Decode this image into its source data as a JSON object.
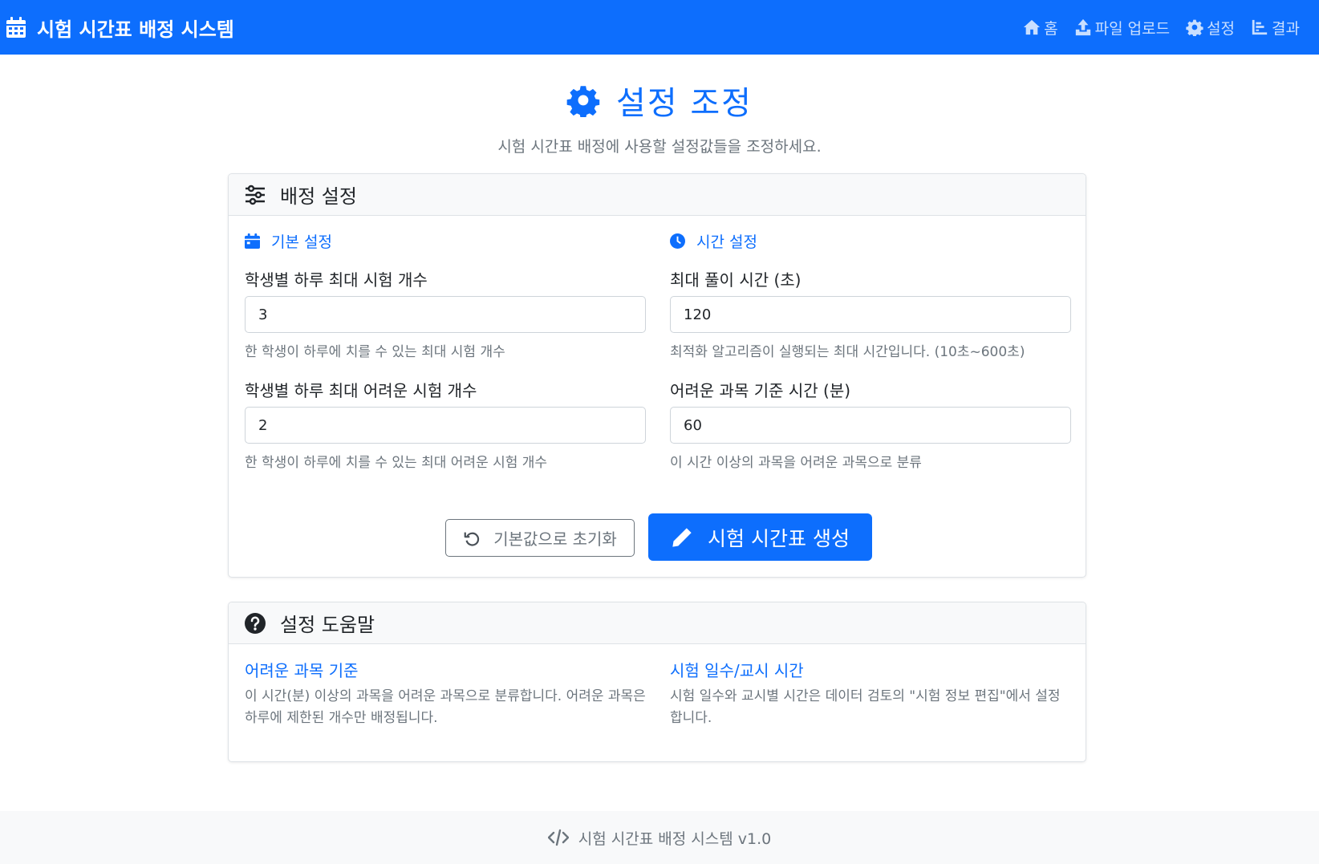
{
  "navbar": {
    "brand": "시험 시간표 배정 시스템",
    "items": [
      {
        "label": "홈",
        "icon": "home-icon"
      },
      {
        "label": "파일 업로드",
        "icon": "upload-icon"
      },
      {
        "label": "설정",
        "icon": "gear-icon"
      },
      {
        "label": "결과",
        "icon": "chart-icon"
      }
    ]
  },
  "header": {
    "title": "설정 조정",
    "subtitle": "시험 시간표 배정에 사용할 설정값들을 조정하세요."
  },
  "settings_card": {
    "title": "배정 설정",
    "basic": {
      "title": "기본 설정",
      "fields": [
        {
          "label": "학생별 하루 최대 시험 개수",
          "value": "3",
          "hint": "한 학생이 하루에 치를 수 있는 최대 시험 개수"
        },
        {
          "label": "학생별 하루 최대 어려운 시험 개수",
          "value": "2",
          "hint": "한 학생이 하루에 치를 수 있는 최대 어려운 시험 개수"
        }
      ]
    },
    "time": {
      "title": "시간 설정",
      "fields": [
        {
          "label": "최대 풀이 시간 (초)",
          "value": "120",
          "hint": "최적화 알고리즘이 실행되는 최대 시간입니다. (10초~600초)"
        },
        {
          "label": "어려운 과목 기준 시간 (분)",
          "value": "60",
          "hint": "이 시간 이상의 과목을 어려운 과목으로 분류"
        }
      ]
    },
    "reset_label": "기본값으로 초기화",
    "generate_label": "시험 시간표 생성"
  },
  "help_card": {
    "title": "설정 도움말",
    "items": [
      {
        "title": "어려운 과목 기준",
        "text": "이 시간(분) 이상의 과목을 어려운 과목으로 분류합니다. 어려운 과목은 하루에 제한된 개수만 배정됩니다."
      },
      {
        "title": "시험 일수/교시 시간",
        "text": "시험 일수와 교시별 시간은 데이터 검토의 \"시험 정보 편집\"에서 설정합니다."
      }
    ]
  },
  "footer": {
    "text": "시험 시간표 배정 시스템 v1.0"
  },
  "colors": {
    "primary": "#0d6efd",
    "muted": "#6c757d",
    "header_bg": "#f8f9fa"
  }
}
